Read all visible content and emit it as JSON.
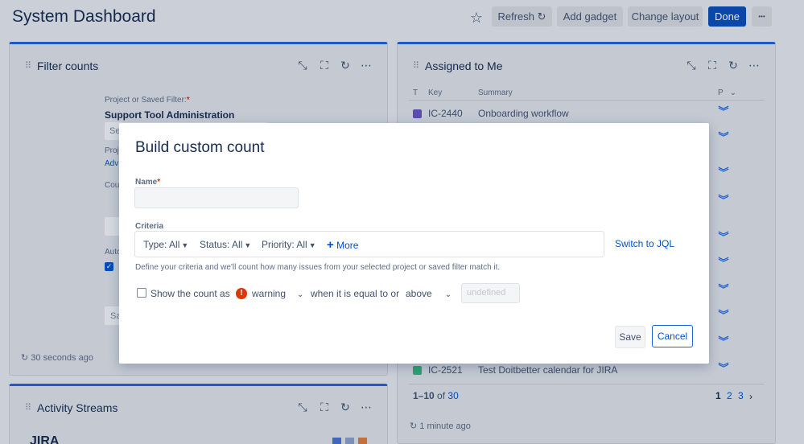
{
  "header": {
    "title": "System Dashboard",
    "refresh_label": "Refresh",
    "add_gadget_label": "Add gadget",
    "change_layout_label": "Change layout",
    "done_label": "Done",
    "more_label": "•••"
  },
  "filter_gadget": {
    "title": "Filter counts",
    "project_label": "Project or Saved Filter:",
    "project_value": "Support Tool Administration",
    "select_partial": "Se",
    "proj_partial": "Proj",
    "adv_partial": "Adv",
    "cou_partial": "Cou",
    "auto_partial": "Auto",
    "save_partial": "Sa",
    "updated": "30 seconds ago"
  },
  "assigned_gadget": {
    "title": "Assigned to Me",
    "columns": {
      "t": "T",
      "key": "Key",
      "summary": "Summary",
      "p": "P"
    },
    "rows": [
      {
        "key": "IC-2440",
        "summary": "Onboarding workflow",
        "type_color": "#6554c0"
      },
      {
        "key": "IC-2521",
        "summary": "Test Doitbetter calendar for JIRA",
        "type_color": "#36b37e"
      }
    ],
    "pagination_range": "1–10",
    "pagination_of": "of",
    "pagination_total": "30",
    "pages": [
      "1",
      "2",
      "3"
    ],
    "updated": "1 minute ago"
  },
  "activity_gadget": {
    "title": "Activity Streams",
    "partial_text": "JIRA"
  },
  "modal": {
    "title": "Build custom count",
    "name_label": "Name",
    "name_value": "",
    "criteria_label": "Criteria",
    "criteria": [
      {
        "label": "Type: All"
      },
      {
        "label": "Status: All"
      },
      {
        "label": "Priority: All"
      }
    ],
    "more_label": "More",
    "switch_label": "Switch to JQL",
    "help_text": "Define your criteria and we'll count how many issues from your selected project or saved filter match it.",
    "show_count_label": "Show the count as",
    "severity_value": "warning",
    "when_label": "when it is equal to or",
    "comparison_value": "above",
    "threshold_placeholder": "undefined",
    "save_label": "Save",
    "cancel_label": "Cancel"
  },
  "colors": {
    "accent": "#0b4db8",
    "gadget_border": "#1f63d6",
    "warning": "#de350b",
    "link": "#0052cc"
  }
}
